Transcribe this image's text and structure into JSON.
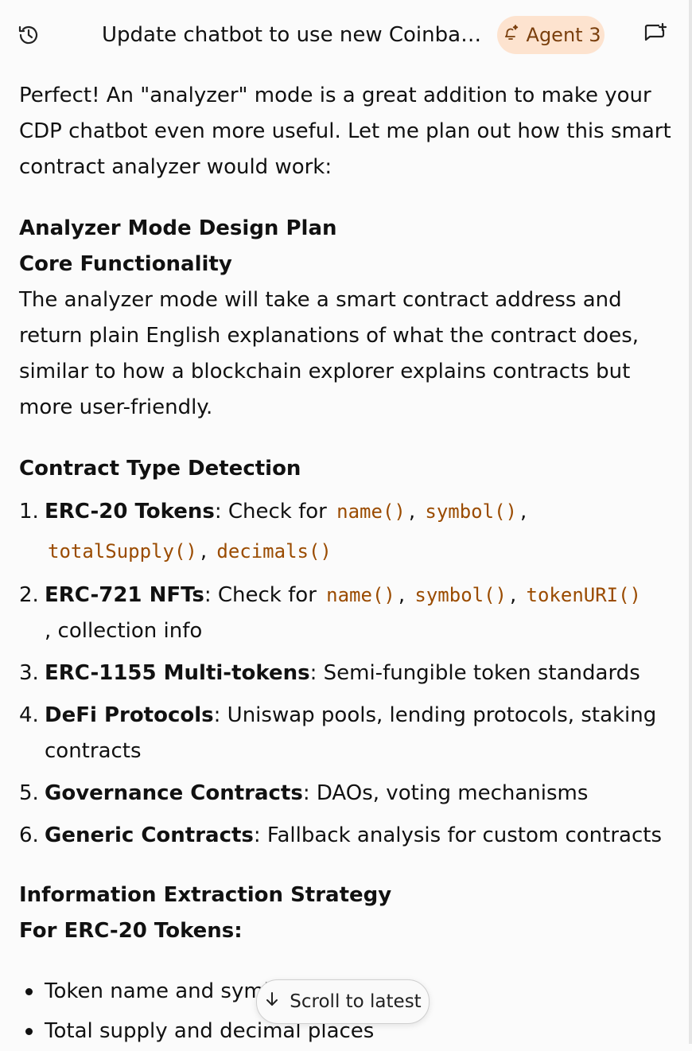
{
  "header": {
    "title": "Update chatbot to use new Coinbase...",
    "agent_label": "Agent 3"
  },
  "intro": "Perfect! An \"analyzer\" mode is a great addition to make your CDP chatbot even more useful. Let me plan out how this smart contract analyzer would work:",
  "section1": {
    "title": "Analyzer Mode Design Plan",
    "subtitle": "Core Functionality",
    "body": "The analyzer mode will take a smart contract address and return plain English explanations of what the contract does, similar to how a blockchain explorer explains contracts but more user-friendly."
  },
  "section2": {
    "title": "Contract Type Detection",
    "items": [
      {
        "num": "1.",
        "bold": "ERC-20 Tokens",
        "text": ": Check for ",
        "codes": [
          "name()",
          "symbol()",
          "totalSupply()",
          "decimals()"
        ]
      },
      {
        "num": "2.",
        "bold": "ERC-721 NFTs",
        "text": ": Check for ",
        "codes": [
          "name()",
          "symbol()",
          "tokenURI()"
        ],
        "tail": ", collection info"
      },
      {
        "num": "3.",
        "bold": "ERC-1155 Multi-tokens",
        "text": ": Semi-fungible token standards"
      },
      {
        "num": "4.",
        "bold": "DeFi Protocols",
        "text": ": Uniswap pools, lending protocols, staking contracts"
      },
      {
        "num": "5.",
        "bold": "Governance Contracts",
        "text": ": DAOs, voting mechanisms"
      },
      {
        "num": "6.",
        "bold": "Generic Contracts",
        "text": ": Fallback analysis for custom contracts"
      }
    ]
  },
  "section3": {
    "title": "Information Extraction Strategy",
    "subtitle": "For ERC-20 Tokens:",
    "bullets": [
      "Token name and symbol",
      "Total supply and decimal places"
    ]
  },
  "scroll_button": {
    "label": "Scroll to latest"
  },
  "colors": {
    "code": "#9a4b00",
    "agent_bg": "#fde3cf",
    "agent_text": "#7a3f0d"
  }
}
